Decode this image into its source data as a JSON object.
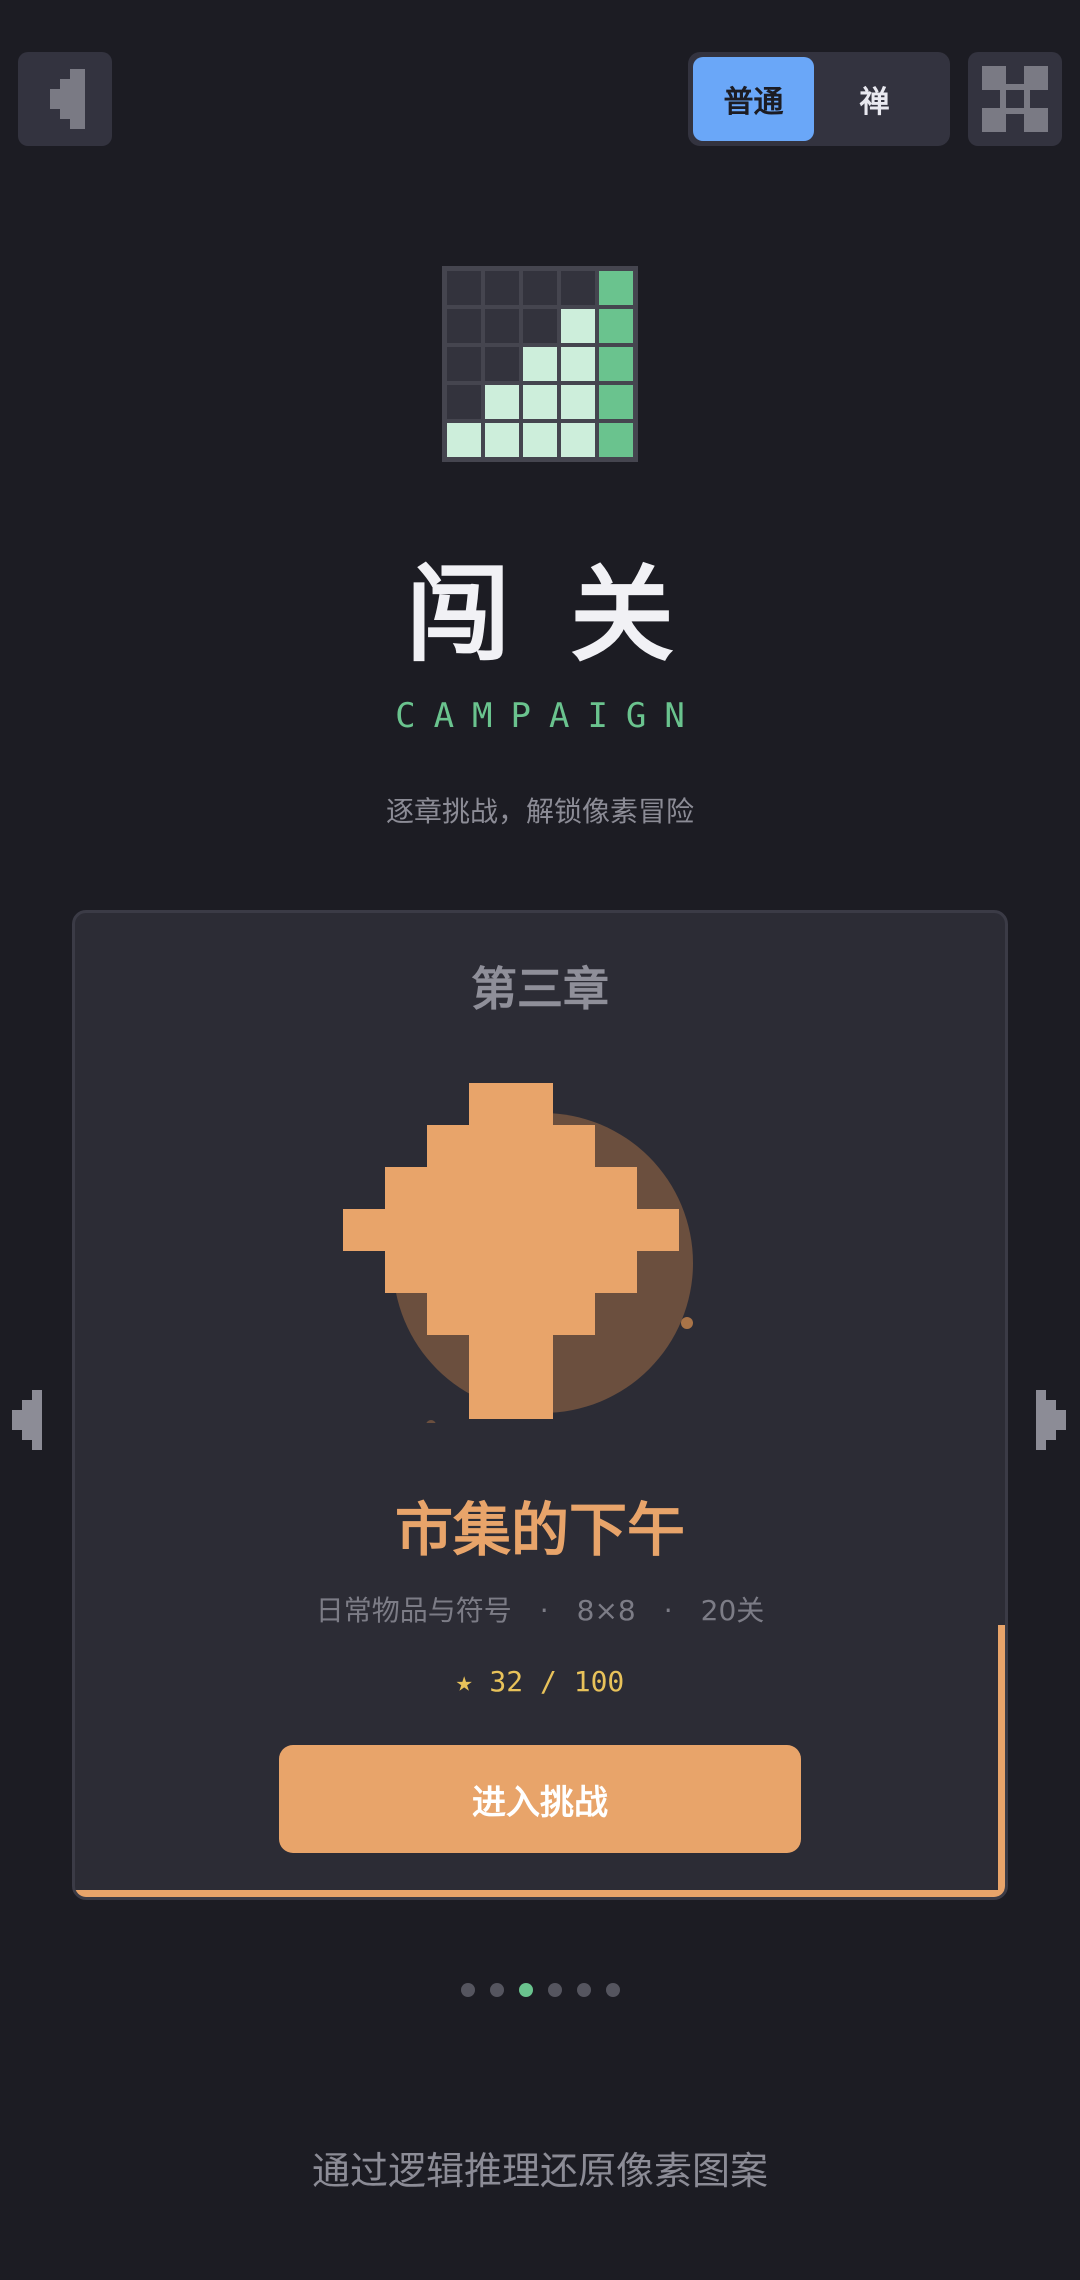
{
  "topbar": {
    "back_icon": "pixel-left-arrow-icon",
    "modes": [
      {
        "label": "普通",
        "active": true
      },
      {
        "label": "禅",
        "active": false
      }
    ],
    "fullscreen_icon": "pixel-fullscreen-icon"
  },
  "hero": {
    "title": "闯关",
    "subtitle": "CAMPAIGN",
    "tagline": "逐章挑战，解锁像素冒险",
    "logo_icon": "nonogram-grid-icon"
  },
  "chapter": {
    "label": "第三章",
    "name": "市集的下午",
    "category": "日常物品与符号",
    "grid_size": "8×8",
    "level_count": "20关",
    "stars": "★ 32 / 100",
    "enter_label": "进入挑战",
    "art_icon": "pixel-compass-star-icon"
  },
  "pager": {
    "total": 6,
    "current": 3
  },
  "footer": {
    "text": "通过逻辑推理还原像素图案"
  },
  "colors": {
    "background": "#1c1c23",
    "card": "#2c2c35",
    "accent_orange": "#e8a46a",
    "accent_green": "#6ac38e",
    "accent_blue": "#6aa7f8",
    "star_yellow": "#e8c25a"
  }
}
